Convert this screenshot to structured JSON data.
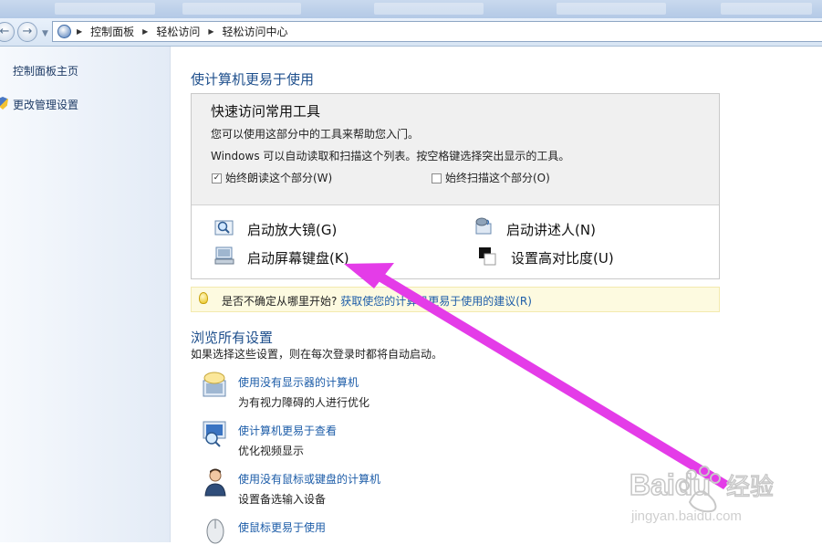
{
  "address": {
    "crumbs": [
      "控制面板",
      "轻松访问",
      "轻松访问中心"
    ]
  },
  "sidebar": {
    "items": [
      {
        "label": "控制面板主页"
      },
      {
        "label": "更改管理设置"
      }
    ]
  },
  "main": {
    "heading": "使计算机更易于使用",
    "quick": {
      "title": "快速访问常用工具",
      "desc1": "您可以使用这部分中的工具来帮助您入门。",
      "desc2": "Windows 可以自动读取和扫描这个列表。按空格键选择突出显示的工具。",
      "read_label": "始终朗读这个部分(W)",
      "read_checked": true,
      "scan_label": "始终扫描这个部分(O)",
      "scan_checked": false,
      "tools": [
        {
          "label": "启动放大镜(G)",
          "icon": "magnifier-icon"
        },
        {
          "label": "启动讲述人(N)",
          "icon": "narrator-icon"
        },
        {
          "label": "启动屏幕键盘(K)",
          "icon": "onscreen-keyboard-icon"
        },
        {
          "label": "设置高对比度(U)",
          "icon": "high-contrast-icon"
        }
      ]
    },
    "tip": {
      "text": "是否不确定从哪里开始?",
      "link": "获取使您的计算机更易于使用的建议(R)"
    },
    "browse": {
      "heading": "浏览所有设置",
      "subtitle": "如果选择这些设置，则在每次登录时都将自动启动。",
      "items": [
        {
          "title": "使用没有显示器的计算机",
          "desc": "为有视力障碍的人进行优化"
        },
        {
          "title": "使计算机更易于查看",
          "desc": "优化视频显示"
        },
        {
          "title": "使用没有鼠标或键盘的计算机",
          "desc": "设置备选输入设备"
        },
        {
          "title": "使鼠标更易于使用",
          "desc": ""
        }
      ]
    }
  },
  "watermark": {
    "brand": "Baidu",
    "brand_cn": "经验",
    "url": "jingyan.baidu.com"
  },
  "colors": {
    "link": "#1c5ca8",
    "heading": "#1e4f8c",
    "arrow": "#e43ce8"
  }
}
